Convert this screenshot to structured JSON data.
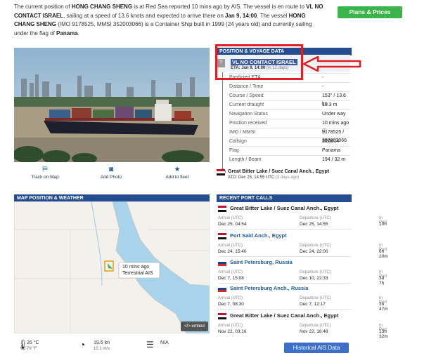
{
  "intro": {
    "t1": "The current position of ",
    "vessel": "HONG CHANG SHENG",
    "t2": " is at Red Sea reported 10 mins ago by AIS. The vessel is en route to ",
    "destination": "VL NO CONTACT ISRAEL",
    "t3": ", sailing at a speed of 13.6 knots and expected to arrive there on ",
    "eta": "Jan 9, 14:00",
    "t4": ". The vessel ",
    "vessel2": "HONG CHANG SHENG",
    "t5": " (IMO 9178525, MMSI 352003066) is a Container Ship built in 1999 (24 years old) and currently sailing under the flag of ",
    "flag": "Panama",
    "t6": "."
  },
  "plans_button": "Plans & Prices",
  "photo_actions": [
    "Track on Map",
    "Add Photo",
    "Add to fleet"
  ],
  "voyage": {
    "header": "POSITION & VOYAGE DATA",
    "dest_icon": "?",
    "dest_name": "VL NO CONTACT ISRAEL",
    "dest_eta": "ETA: Jan 9, 14:00",
    "dest_eta_note": "(in 12 days)",
    "rows": [
      {
        "k": "Predicted ETA",
        "v": "-"
      },
      {
        "k": "Distance / Time",
        "v": "-"
      },
      {
        "k": "Course / Speed",
        "v": "153° / 13.6 kn"
      },
      {
        "k": "Current draught",
        "v": "10.3 m"
      },
      {
        "k": "Navigation Status",
        "v": "Under way"
      },
      {
        "k": "Position received",
        "v": "10 mins ago ⓘ"
      },
      {
        "k": "IMO / MMSI",
        "v": "9178525 / 352003066"
      },
      {
        "k": "Callsign",
        "v": "3E6614"
      },
      {
        "k": "Flag",
        "v": "Panama"
      },
      {
        "k": "Length / Beam",
        "v": "194 / 32 m"
      }
    ],
    "atd_name": "Great Bitter Lake / Suez Canal Anch., Egypt",
    "atd_time": "ATD: Dec 25, 14:55 UTC",
    "atd_note": "(3 days ago)"
  },
  "map_header": "MAP POSITION & WEATHER",
  "map_popup": {
    "line1": "10 mins ago",
    "line2": "Terrestrial AIS"
  },
  "embed_label": "</> embed",
  "weather": {
    "temp_c": "26 °C",
    "temp_f": "79 °F",
    "wind_kn": "19.6 kn",
    "wind_ms": "10.1 m/s",
    "waves": "N/A"
  },
  "port_calls": {
    "header": "RECENT PORT CALLS",
    "arrival_label": "Arrival (UTC)",
    "departure_label": "Departure (UTC)",
    "inport_label": "In Port",
    "first": {
      "name": "Great Bitter Lake / Suez Canal Anch., Egypt",
      "arr": "Dec 25, 04:54",
      "dep": "Dec 25, 14:55",
      "inport": "10h"
    },
    "second": {
      "name": "Port Said Anch., Egypt",
      "arr": "Dec 24, 15:40",
      "dep": "Dec 24, 22:00",
      "inport": "6h 20m"
    },
    "third": {
      "name": "Saint Petersburg, Russia",
      "arr": "Dec 7, 15:08",
      "dep": "Dec 10, 22:33",
      "inport": "3d 7h"
    },
    "fourth": {
      "name": "Saint Petersburg Anch., Russia",
      "arr": "Dec 7, 08:30",
      "dep": "Dec 7, 12:17",
      "inport": "3h 47m"
    },
    "fifth": {
      "name": "Great Bitter Lake / Suez Canal Anch., Egypt",
      "arr": "Nov 22, 03:16",
      "dep": "Nov 22, 16:48",
      "inport": "13h 32m"
    }
  },
  "history_button": "Historical AIS Data",
  "colors": {
    "header_bg": "#244d91",
    "green_button": "#3bb54a",
    "blue_button": "#3d6fc9",
    "highlight_red": "#e02020"
  }
}
